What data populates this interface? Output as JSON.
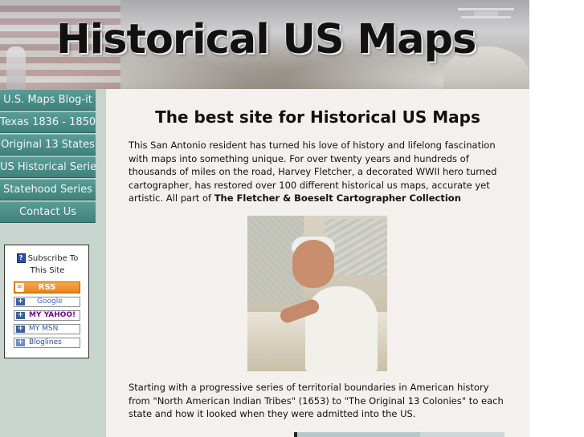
{
  "banner": {
    "title": "Historical US Maps"
  },
  "nav": {
    "items": [
      {
        "label": "U.S. Maps Blog-it"
      },
      {
        "label": "Texas 1836 - 1850"
      },
      {
        "label": "Original 13 States"
      },
      {
        "label": "US Historical Series"
      },
      {
        "label": "Statehood Series"
      },
      {
        "label": "Contact Us"
      }
    ]
  },
  "subscribe": {
    "help_icon": "?",
    "heading": "Subscribe To This Site",
    "rss_label": "RSS",
    "feeds": [
      {
        "label": "Google"
      },
      {
        "label": "MY YAHOO!"
      },
      {
        "label": "MY MSN"
      },
      {
        "label": "Bloglines"
      }
    ]
  },
  "content": {
    "heading": "The best site for Historical US Maps",
    "intro": "This San Antonio resident has turned his love of history and lifelong fascination with maps into something unique. For over twenty years and hundreds of thousands of miles on the road, Harvey Fletcher, a decorated WWII hero turned cartographer, has restored over 100 different historical us maps, accurate yet artistic. All part of ",
    "intro_bold": "The Fletcher & Boeselt Cartographer Collection",
    "second": "Starting with a progressive series of territorial boundaries in American history from \"North American Indian Tribes\" (1653) to \"The Original 13 Colonies\" to each state and how it looked when they were admitted into the US."
  },
  "colors": {
    "nav_bg": "#4a8f89",
    "sidebar_bg": "#c8d4ce",
    "content_bg": "#f3f0ed",
    "rss_orange": "#e9821d"
  }
}
